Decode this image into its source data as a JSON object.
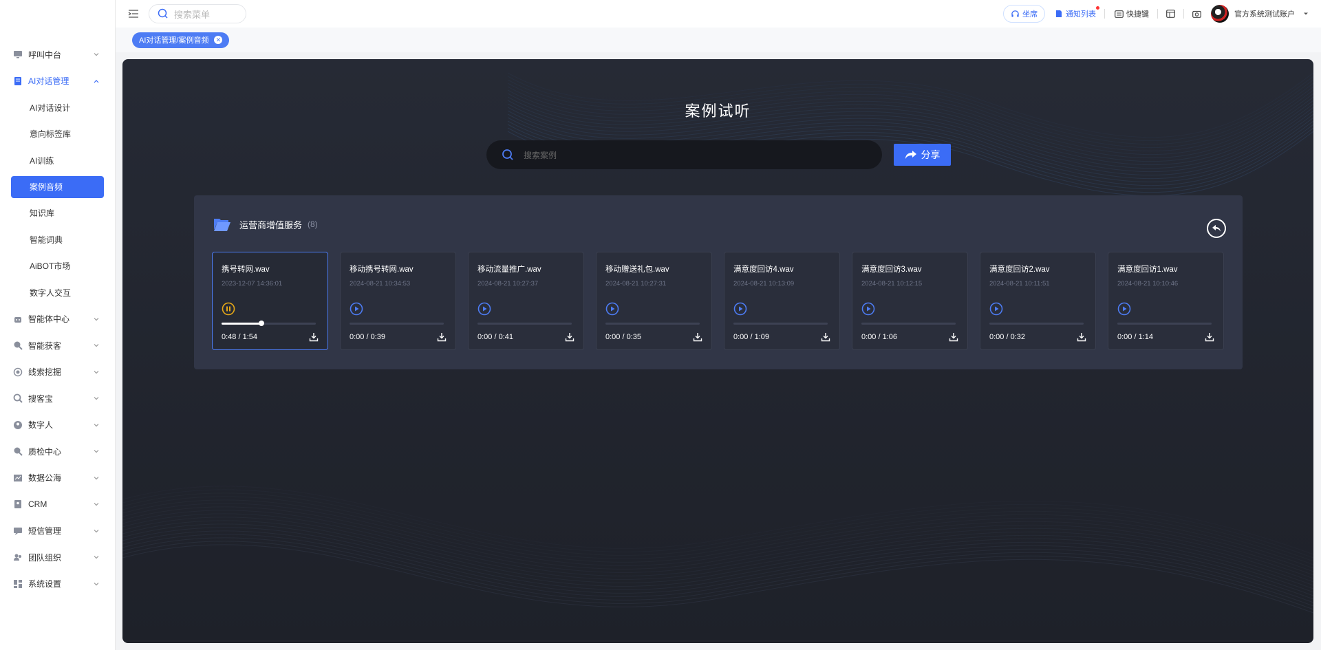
{
  "sidebar": {
    "items": [
      {
        "label": "呼叫中台",
        "icon": "monitor-icon",
        "expanded": false
      },
      {
        "label": "AI对话管理",
        "icon": "book-icon",
        "expanded": true,
        "active": true,
        "children": [
          {
            "label": "AI对话设计"
          },
          {
            "label": "意向标签库"
          },
          {
            "label": "AI训练"
          },
          {
            "label": "案例音频",
            "active": true
          },
          {
            "label": "知识库"
          },
          {
            "label": "智能词典"
          },
          {
            "label": "AiBOT市场"
          },
          {
            "label": "数字人交互"
          }
        ]
      },
      {
        "label": "智能体中心",
        "icon": "robot-icon",
        "expanded": false
      },
      {
        "label": "智能获客",
        "icon": "search-user-icon",
        "expanded": false
      },
      {
        "label": "线索挖掘",
        "icon": "target-icon",
        "expanded": false
      },
      {
        "label": "搜客宝",
        "icon": "magnifier-icon",
        "expanded": false
      },
      {
        "label": "数字人",
        "icon": "person-icon",
        "expanded": false
      },
      {
        "label": "质检中心",
        "icon": "check-search-icon",
        "expanded": false
      },
      {
        "label": "数据公海",
        "icon": "chart-icon",
        "expanded": false
      },
      {
        "label": "CRM",
        "icon": "contact-icon",
        "expanded": false
      },
      {
        "label": "短信管理",
        "icon": "message-icon",
        "expanded": false
      },
      {
        "label": "团队组织",
        "icon": "team-icon",
        "expanded": false
      },
      {
        "label": "系统设置",
        "icon": "dashboard-icon",
        "expanded": false
      }
    ]
  },
  "topbar": {
    "search_placeholder": "搜索菜单",
    "seat_label": "坐席",
    "notify_label": "通知列表",
    "shortcut_label": "快捷键",
    "account_label": "官方系统测试账户"
  },
  "tabs": [
    {
      "label": "AI对话管理/案例音频"
    }
  ],
  "page": {
    "title": "案例试听",
    "search_placeholder": "搜索案例",
    "share_label": "分享",
    "folder": {
      "name": "运营商增值服务",
      "count": "(8)"
    }
  },
  "audios": [
    {
      "name": "携号转网.wav",
      "date": "2023-12-07 14:36:01",
      "time": "0:48 / 1:54",
      "progress": 0.42,
      "playing": true
    },
    {
      "name": "移动携号转网.wav",
      "date": "2024-08-21 10:34:53",
      "time": "0:00 / 0:39",
      "progress": 0,
      "playing": false
    },
    {
      "name": "移动流量推广.wav",
      "date": "2024-08-21 10:27:37",
      "time": "0:00 / 0:41",
      "progress": 0,
      "playing": false
    },
    {
      "name": "移动赠送礼包.wav",
      "date": "2024-08-21 10:27:31",
      "time": "0:00 / 0:35",
      "progress": 0,
      "playing": false
    },
    {
      "name": "满意度回访4.wav",
      "date": "2024-08-21 10:13:09",
      "time": "0:00 / 1:09",
      "progress": 0,
      "playing": false
    },
    {
      "name": "满意度回访3.wav",
      "date": "2024-08-21 10:12:15",
      "time": "0:00 / 1:06",
      "progress": 0,
      "playing": false
    },
    {
      "name": "满意度回访2.wav",
      "date": "2024-08-21 10:11:51",
      "time": "0:00 / 0:32",
      "progress": 0,
      "playing": false
    },
    {
      "name": "满意度回访1.wav",
      "date": "2024-08-21 10:10:46",
      "time": "0:00 / 1:14",
      "progress": 0,
      "playing": false
    }
  ],
  "colors": {
    "accent": "#3b6cf6",
    "playing": "#e6a817",
    "panel_bg": "#262a35"
  }
}
